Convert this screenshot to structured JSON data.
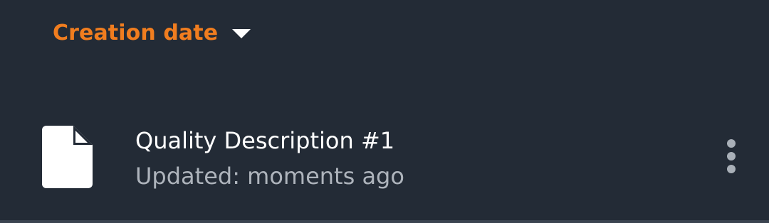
{
  "sort": {
    "label": "Creation date",
    "icon": "caret-down-icon",
    "color": "#f07d1f"
  },
  "files": [
    {
      "icon": "document-icon",
      "title": "Quality Description #1",
      "subtitle": "Updated: moments ago",
      "menu_icon": "more-vert-icon"
    }
  ],
  "colors": {
    "background": "#232b36",
    "title": "#ffffff",
    "subtitle": "#aeb4bc"
  }
}
